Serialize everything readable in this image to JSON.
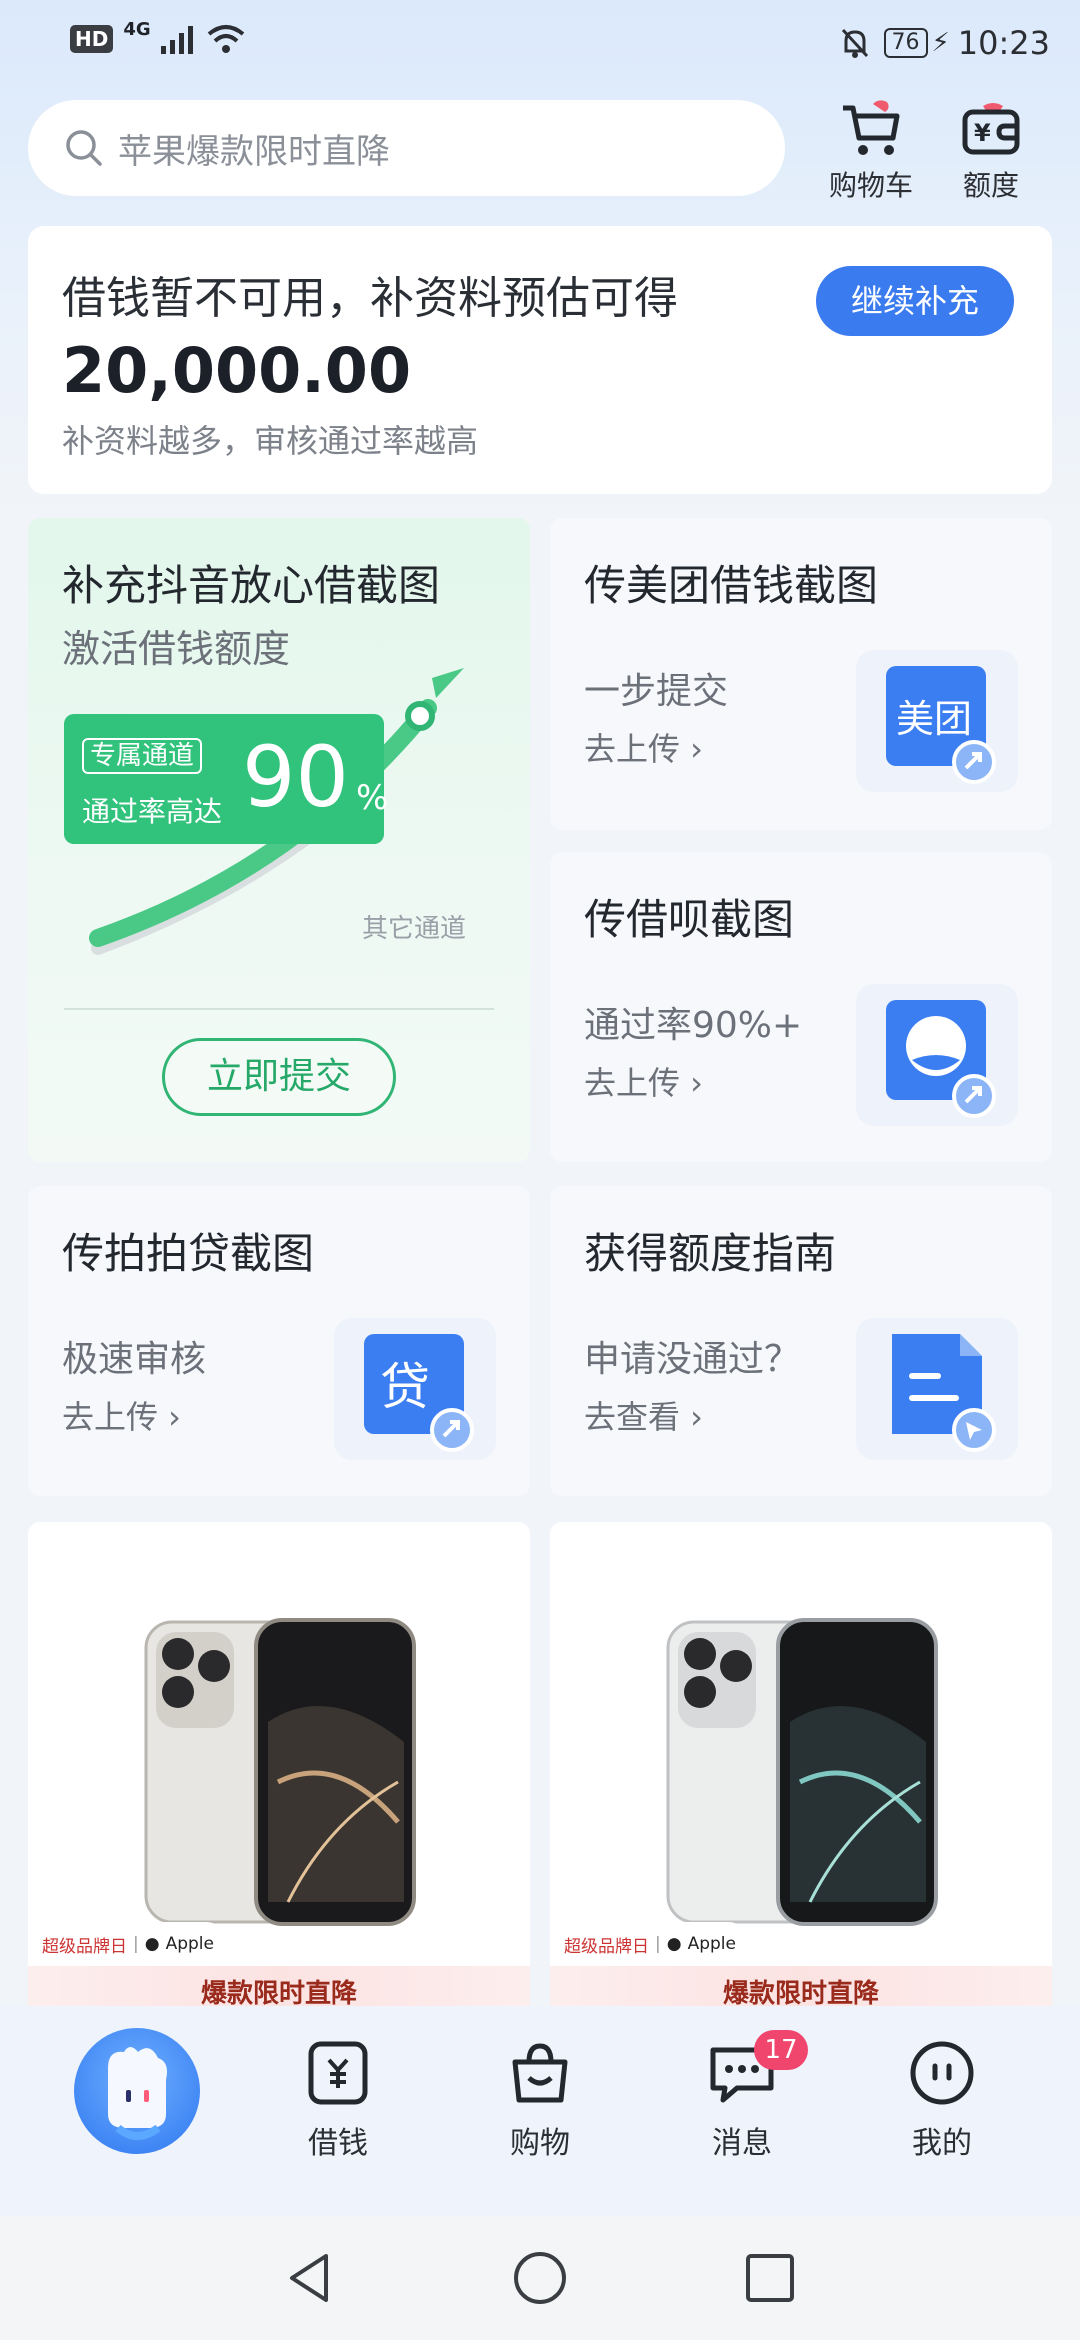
{
  "status_bar": {
    "hd": "HD",
    "network": "4G",
    "battery": "76",
    "time": "10:23"
  },
  "search": {
    "placeholder": "苹果爆款限时直降"
  },
  "header_icons": {
    "cart_label": "购物车",
    "quota_label": "额度"
  },
  "credit": {
    "title": "借钱暂不可用，补资料预估可得",
    "amount": "20,000.00",
    "subtitle": "补资料越多，审核通过率越高",
    "button": "继续补充"
  },
  "feature": {
    "title": "补充抖音放心借截图",
    "subtitle": "激活借钱额度",
    "tag": "专属通道",
    "rate_text": "通过率高达",
    "rate": "90",
    "percent": "%",
    "other_channel": "其它通道",
    "button": "立即提交"
  },
  "tiles": {
    "meituan": {
      "title": "传美团借钱截图",
      "sub": "一步提交",
      "link": "去上传 ›",
      "icon_text": "美团"
    },
    "jiebei": {
      "title": "传借呗截图",
      "sub": "通过率90%+",
      "link": "去上传 ›"
    },
    "paipai": {
      "title": "传拍拍贷截图",
      "sub": "极速审核",
      "link": "去上传 ›",
      "icon_text": "贷"
    },
    "guide": {
      "title": "获得额度指南",
      "sub": "申请没通过？",
      "link": "去查看 ›"
    }
  },
  "products": [
    {
      "brand_tag": "超级品牌日",
      "brand": "Apple",
      "promo": "爆款限时直降"
    },
    {
      "brand_tag": "超级品牌日",
      "brand": "Apple",
      "promo": "爆款限时直降"
    }
  ],
  "nav": {
    "borrow": "借钱",
    "shop": "购物",
    "messages": "消息",
    "messages_badge": "17",
    "mine": "我的"
  }
}
